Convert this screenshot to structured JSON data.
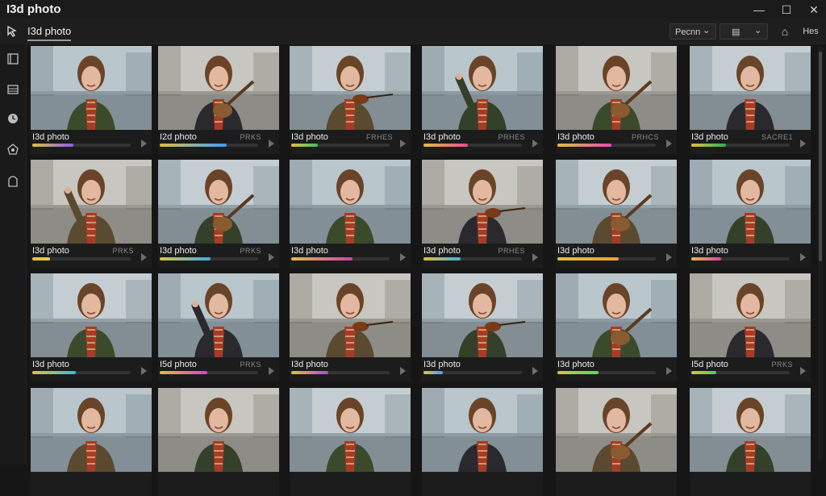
{
  "window": {
    "title": "I3d photo",
    "minimize": "—",
    "maximize": "☐",
    "close": "✕"
  },
  "toolbar": {
    "active_tab": "I3d photo",
    "sort_label": "Pecnn",
    "sort_chevron": "⌄",
    "view_label": "▤",
    "view_chevron": "⌄",
    "home_icon": "⌂",
    "filter_label": "Hes"
  },
  "colors": {
    "accent": "#e0e0e0",
    "background": "#161616",
    "cell": "#1c1c1c"
  },
  "grid": {
    "rows": [
      {
        "cells": [
          {
            "caption": "I3d photo",
            "res": "",
            "progress": 0.42,
            "color": "#8a5cf0",
            "variant": "plain"
          },
          {
            "caption": "I2d photo",
            "res": "PRKS",
            "progress": 0.68,
            "color": "#3aa0ff",
            "variant": "guitar"
          },
          {
            "caption": "I3d photo",
            "res": "FRHES",
            "progress": 0.27,
            "color": "#40c060",
            "variant": "violin"
          },
          {
            "caption": "I3d photo",
            "res": "PRHES",
            "progress": 0.45,
            "color": "#e05090",
            "variant": "wave"
          },
          {
            "caption": "I3d photo",
            "res": "PRHCS",
            "progress": 0.55,
            "color": "#e04fb0",
            "variant": "guitar"
          },
          {
            "caption": "I3d photo",
            "res": "SACRE1",
            "progress": 0.35,
            "color": "#30b050",
            "variant": "scarf"
          }
        ]
      },
      {
        "cells": [
          {
            "caption": "I3d photo",
            "res": "PRKS",
            "progress": 0.18,
            "color": "#e0d040",
            "variant": "wave"
          },
          {
            "caption": "I3d photo",
            "res": "PRKS",
            "progress": 0.52,
            "color": "#3ab0e0",
            "variant": "guitar"
          },
          {
            "caption": "I3d photo",
            "res": "",
            "progress": 0.62,
            "color": "#d040b0",
            "variant": "plain"
          },
          {
            "caption": "I3d photo",
            "res": "PRHES",
            "progress": 0.38,
            "color": "#40b0e0",
            "variant": "violin"
          },
          {
            "caption": "I3d photo",
            "res": "",
            "progress": 0.62,
            "color": "#f0a030",
            "variant": "guitar"
          },
          {
            "caption": "I3d photo",
            "res": "",
            "progress": 0.3,
            "color": "#e040a0",
            "variant": "plain"
          }
        ]
      },
      {
        "cells": [
          {
            "caption": "I3d photo",
            "res": "",
            "progress": 0.44,
            "color": "#30c0d0",
            "variant": "plain"
          },
          {
            "caption": "I5d photo",
            "res": "PRKS",
            "progress": 0.48,
            "color": "#e040c0",
            "variant": "wave"
          },
          {
            "caption": "I3d photo",
            "res": "",
            "progress": 0.38,
            "color": "#c040e0",
            "variant": "violin"
          },
          {
            "caption": "I3d photo",
            "res": "",
            "progress": 0.2,
            "color": "#40a0ff",
            "variant": "violin"
          },
          {
            "caption": "I3d photo",
            "res": "",
            "progress": 0.42,
            "color": "#40e060",
            "variant": "guitar"
          },
          {
            "caption": "I5d photo",
            "res": "PRKS",
            "progress": 0.25,
            "color": "#40d060",
            "variant": "scarf"
          }
        ]
      },
      {
        "cells": [
          {
            "caption": "",
            "res": "",
            "progress": 0,
            "color": "#888888",
            "variant": "plain"
          },
          {
            "caption": "",
            "res": "",
            "progress": 0,
            "color": "#888888",
            "variant": "plain"
          },
          {
            "caption": "",
            "res": "",
            "progress": 0,
            "color": "#888888",
            "variant": "plain"
          },
          {
            "caption": "",
            "res": "",
            "progress": 0,
            "color": "#888888",
            "variant": "plain"
          },
          {
            "caption": "",
            "res": "",
            "progress": 0,
            "color": "#888888",
            "variant": "guitar"
          },
          {
            "caption": "",
            "res": "",
            "progress": 0,
            "color": "#888888",
            "variant": "plain"
          }
        ]
      }
    ]
  },
  "sidebar": {
    "icons": [
      "frame-icon",
      "stack-icon",
      "clock-icon",
      "network-icon",
      "export-icon"
    ]
  }
}
